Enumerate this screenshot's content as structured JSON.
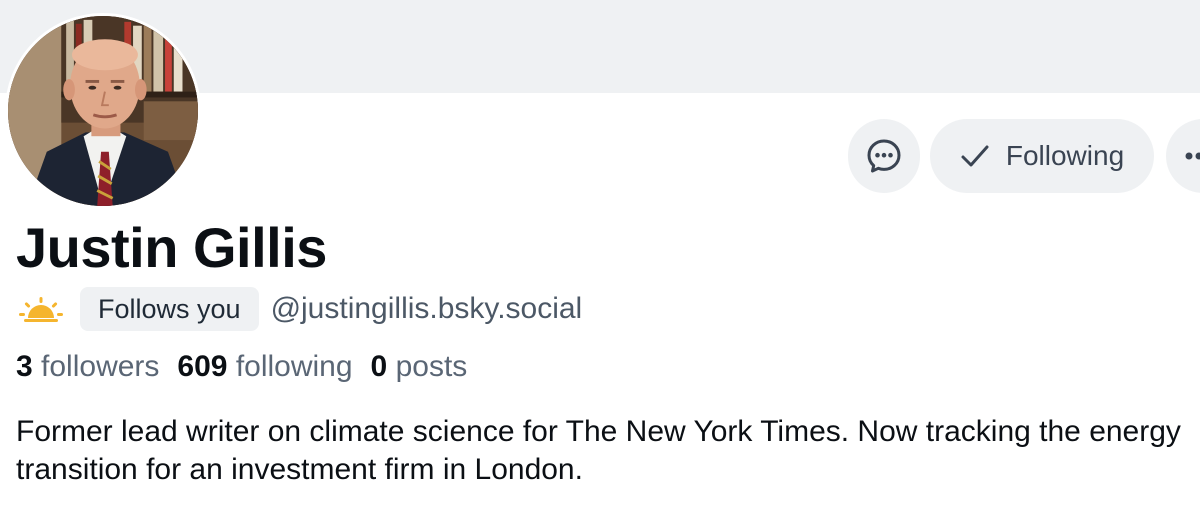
{
  "profile": {
    "display_name": "Justin Gillis",
    "handle": "@justingillis.bsky.social",
    "follows_you_label": "Follows you",
    "new_account_icon": "sun-icon",
    "bio": "Former lead writer on climate science for The New York Times. Now tracking the energy transition for an investment firm in London.",
    "stats": {
      "followers_count": "3",
      "followers_label": "followers",
      "following_count": "609",
      "following_label": "following",
      "posts_count": "0",
      "posts_label": "posts"
    }
  },
  "actions": {
    "message_icon": "chat-bubble-icon",
    "following_label": "Following",
    "following_icon": "check-icon",
    "more_icon": "more-dots-icon"
  },
  "colors": {
    "banner": "#eff1f3",
    "button_bg": "#eff1f3",
    "primary_text": "#0b0f14",
    "secondary_text": "#5a6675",
    "sun_yellow": "#f5b52e"
  }
}
